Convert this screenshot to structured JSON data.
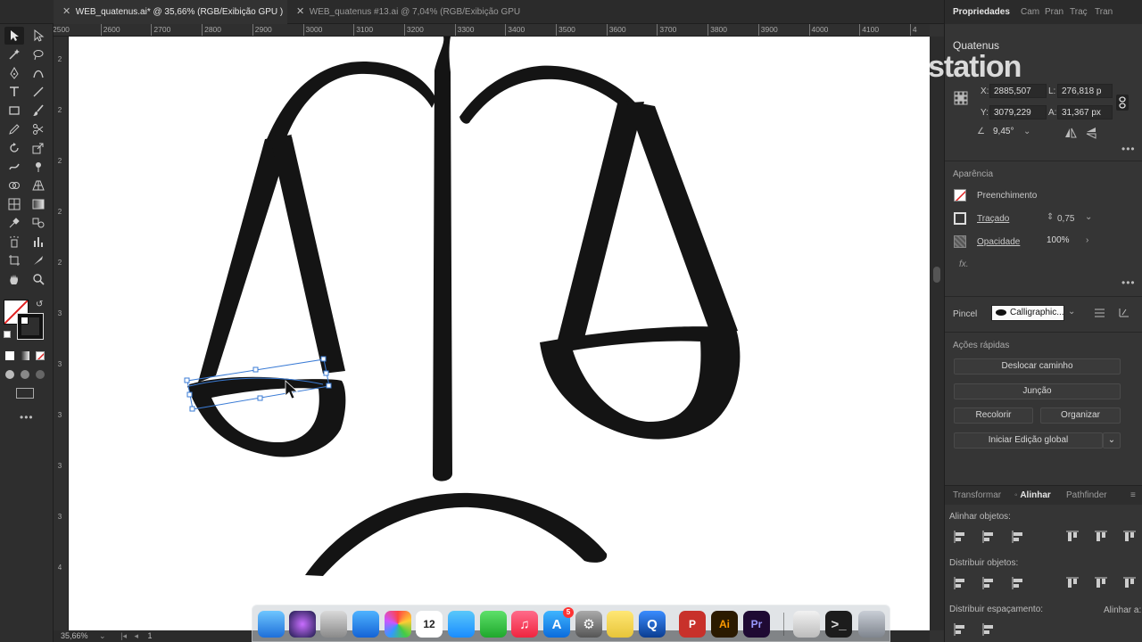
{
  "tabs": [
    {
      "label": "WEB_quatenus.ai* @ 35,66% (RGB/Exibição GPU )",
      "active": true
    },
    {
      "label": "WEB_quatenus #13.ai @ 7,04% (RGB/Exibição GPU )",
      "active": false
    }
  ],
  "ruler_top": [
    "2500",
    "2600",
    "2700",
    "2800",
    "2900",
    "3000",
    "3100",
    "3200",
    "3300",
    "3400",
    "3500",
    "3600",
    "3700",
    "3800",
    "3900",
    "4000",
    "4100",
    "4"
  ],
  "ruler_left": [
    "2",
    "2",
    "2",
    "2",
    "2",
    "3",
    "3",
    "3",
    "3",
    "3",
    "4"
  ],
  "status": {
    "zoom": "35,66%",
    "page": "1"
  },
  "panel_tabs": [
    "Propriedades",
    "Cam",
    "Pran",
    "Traç",
    "Tran"
  ],
  "transform": {
    "x_label": "X:",
    "x_value": "2885,507",
    "y_label": "Y:",
    "y_value": "3079,229",
    "w_label": "L:",
    "w_value": "276,818 p",
    "h_label": "A:",
    "h_value": "31,367 px",
    "angle_value": "9,45°"
  },
  "appearance": {
    "title": "Aparência",
    "fill_label": "Preenchimento",
    "stroke_label": "Traçado",
    "stroke_value": "0,75",
    "opacity_label": "Opacidade",
    "opacity_value": "100%",
    "fx_label": "fx."
  },
  "brush": {
    "label": "Pincel",
    "value": "Calligraphic..."
  },
  "quick_actions": {
    "title": "Ações rápidas",
    "offset_path": "Deslocar caminho",
    "join": "Junção",
    "recolor": "Recolorir",
    "arrange": "Organizar",
    "global_edit": "Iniciar Edição global"
  },
  "align_tabs": [
    "Transformar",
    "Alinhar",
    "Pathfinder"
  ],
  "align": {
    "align_objects": "Alinhar objetos:",
    "distribute_objects": "Distribuir objetos:",
    "distribute_spacing": "Distribuir espaçamento:",
    "align_to": "Alinhar a:"
  },
  "watermark": {
    "brand": "station",
    "sub": "Quatenus"
  },
  "dock_apps": [
    "Finder",
    "Siri",
    "Launchpad",
    "Safari",
    "Photos",
    "12",
    "Messages",
    "FaceTime",
    "Music",
    "App Store",
    "System Preferences",
    "Notes",
    "QuickTime",
    "P",
    "Ai",
    "Pr",
    "Preview",
    "Terminal",
    "Trash"
  ],
  "dock_badges": {
    "app_store": "5"
  },
  "colors": {
    "accent": "#1473e6",
    "ink": "#141414",
    "illustrator": "#ff9a00",
    "premiere": "#9999ff"
  }
}
